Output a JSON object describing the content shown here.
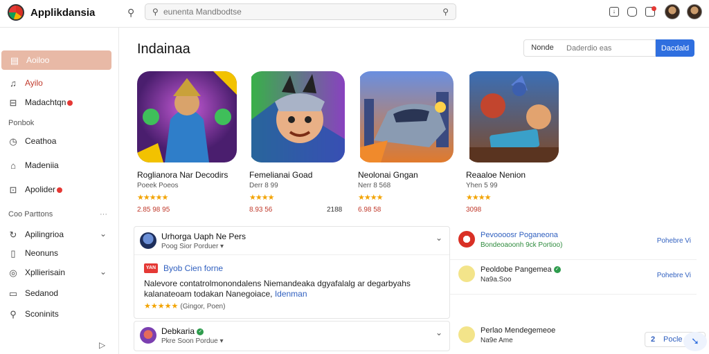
{
  "app": {
    "title": "Applikdansia",
    "search_placeholder": "eunenta Mandbodtse"
  },
  "sidebar": {
    "items": [
      {
        "label": "Aoiloo",
        "icon": "store-icon",
        "active": true
      },
      {
        "label": "Ayilo",
        "icon": "bell-icon"
      },
      {
        "label": "Madachtqn",
        "icon": "inbox-icon",
        "badge": true
      }
    ],
    "section1": "Ponbok",
    "items2": [
      {
        "label": "Ceathoa",
        "icon": "clock-icon"
      },
      {
        "label": "Madeniia",
        "icon": "home-icon"
      },
      {
        "label": "Apolider",
        "icon": "chart-icon",
        "badge": true
      }
    ],
    "section2": "Coo Parttons",
    "section2_more": "···",
    "items3": [
      {
        "label": "Apilingrioa",
        "icon": "refresh-icon",
        "chevron": true
      },
      {
        "label": "Neonuns",
        "icon": "file-icon"
      },
      {
        "label": "Xpllierisain",
        "icon": "globe-icon",
        "chevron": true
      },
      {
        "label": "Sedanod",
        "icon": "folder-icon"
      },
      {
        "label": "Sconinits",
        "icon": "tools-icon"
      }
    ]
  },
  "main": {
    "title": "Indainaa",
    "filter_label": "Nonde",
    "filter_placeholder": "Daderdio eas",
    "filter_button": "Dacdald"
  },
  "games": [
    {
      "name": "Roglianora Nar Decodirs",
      "meta": "Poeek Poeos",
      "rating": 4.5,
      "stars": "★★★★★",
      "price": "2.85 98 95",
      "price2": ""
    },
    {
      "name": "Femelianai Goad",
      "meta": "Derr 8 99",
      "rating": 4.0,
      "stars": "★★★★",
      "price": "8.93 56",
      "price2": "2188"
    },
    {
      "name": "Neolonai Gngan",
      "meta": "Nerr 8 568",
      "rating": 4.5,
      "stars": "★★★★",
      "price": "6.98 58",
      "price2": ""
    },
    {
      "name": "Reaaloe Nenion",
      "meta": "Yhen 5 99",
      "rating": 4.0,
      "stars": "★★★★",
      "price": "3098",
      "price2": ""
    }
  ],
  "reviews": [
    {
      "name": "Urhorga Uaph Ne Pers",
      "sub": "Poog Sior Porduer ▾",
      "tag": "YAN",
      "tag_title": "Byob Cien forne",
      "text": "Nalevore contatrolmonondalens Niemandeaka dgyafalalg ar degarbyahs kalanateoam todakan Nanegoiace,",
      "link": "Idenman",
      "stars": "★★★★★",
      "stars_note": "(Gingor, Poen)"
    },
    {
      "name": "Debkaria",
      "sub": "Pkre Soon Pordue ▾"
    }
  ],
  "activity": [
    {
      "title": "Pevoooosr Poganeona",
      "sub": "Bondeoaoonh 9ck Portioo)",
      "sub_green": true,
      "link": "Pohebre Vi"
    },
    {
      "title": "Peoldobe Pangemea",
      "sub": "Na9a.Soo",
      "verified": true,
      "link": "Pohebre Vi"
    },
    {
      "title": "Perlao Mendegemeoe",
      "sub": "Na9e Ame",
      "link": ""
    }
  ],
  "pagination": {
    "page": "2",
    "label": "Pocle"
  }
}
